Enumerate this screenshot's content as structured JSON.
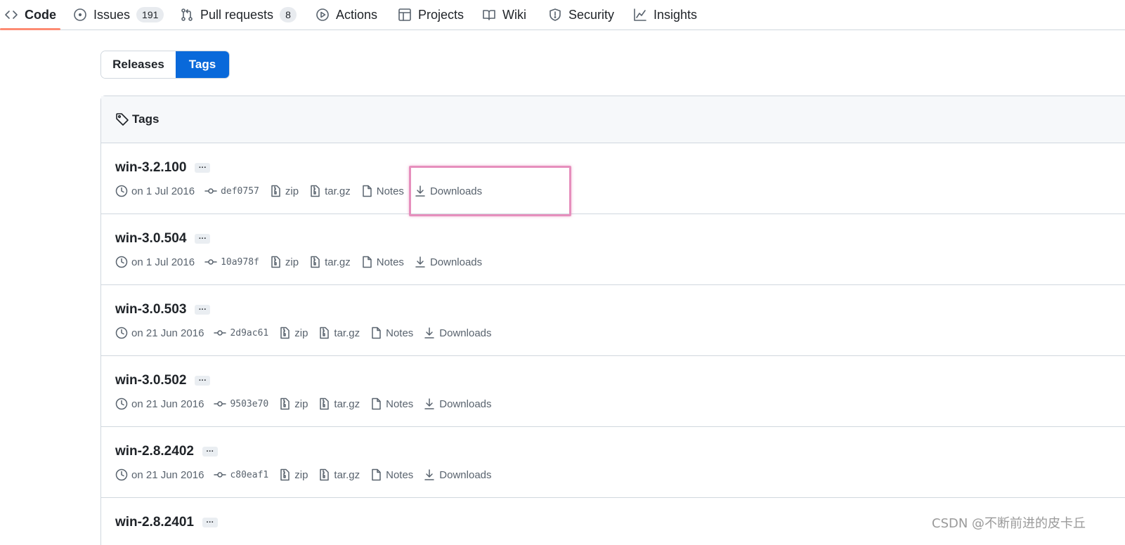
{
  "repo_nav": {
    "items": [
      {
        "label": "Code",
        "icon": "code-icon",
        "selected": true
      },
      {
        "label": "Issues",
        "icon": "issue-opened-icon",
        "count": "191"
      },
      {
        "label": "Pull requests",
        "icon": "git-pull-request-icon",
        "count": "8"
      },
      {
        "label": "Actions",
        "icon": "play-icon"
      },
      {
        "label": "Projects",
        "icon": "table-icon"
      },
      {
        "label": "Wiki",
        "icon": "book-icon"
      },
      {
        "label": "Security",
        "icon": "shield-icon"
      },
      {
        "label": "Insights",
        "icon": "graph-icon"
      }
    ]
  },
  "segmented": {
    "releases_label": "Releases",
    "tags_label": "Tags",
    "active": "Tags"
  },
  "tags_box": {
    "header": "Tags",
    "rows": [
      {
        "name": "win-3.2.100",
        "date": "on 1 Jul 2016",
        "commit": "def0757",
        "zip": "zip",
        "targz": "tar.gz",
        "notes": "Notes",
        "downloads": "Downloads"
      },
      {
        "name": "win-3.0.504",
        "date": "on 1 Jul 2016",
        "commit": "10a978f",
        "zip": "zip",
        "targz": "tar.gz",
        "notes": "Notes",
        "downloads": "Downloads"
      },
      {
        "name": "win-3.0.503",
        "date": "on 21 Jun 2016",
        "commit": "2d9ac61",
        "zip": "zip",
        "targz": "tar.gz",
        "notes": "Notes",
        "downloads": "Downloads"
      },
      {
        "name": "win-3.0.502",
        "date": "on 21 Jun 2016",
        "commit": "9503e70",
        "zip": "zip",
        "targz": "tar.gz",
        "notes": "Notes",
        "downloads": "Downloads"
      },
      {
        "name": "win-2.8.2402",
        "date": "on 21 Jun 2016",
        "commit": "c80eaf1",
        "zip": "zip",
        "targz": "tar.gz",
        "notes": "Notes",
        "downloads": "Downloads"
      },
      {
        "name": "win-2.8.2401"
      }
    ],
    "ellipsis": "···"
  },
  "watermark": "CSDN @不断前进的皮卡丘",
  "colors": {
    "accent": "#0969da",
    "underline": "#fd8c73",
    "highlight": "#e68fbd"
  }
}
